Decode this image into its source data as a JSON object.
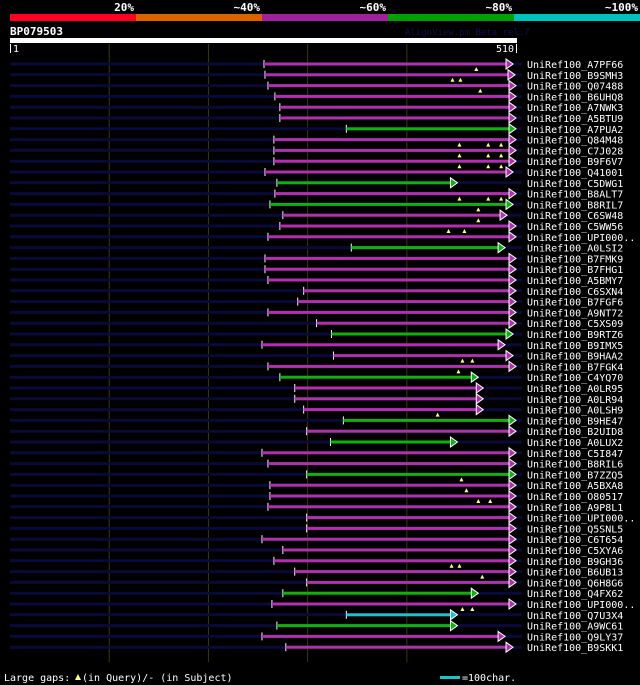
{
  "color_scale": {
    "labels": [
      "20%",
      "~40%",
      "~60%",
      "~80%",
      "~100%"
    ],
    "colors": [
      "#ff0022",
      "#e06000",
      "#a020a0",
      "#00a000",
      "#00c0c0"
    ]
  },
  "query": {
    "name": "BP079503",
    "start_label": "1",
    "end_label": "510",
    "length": 510
  },
  "watermark": "AlignView.pm Beta rel.7",
  "colors": {
    "magenta": "#b030b0",
    "green": "#10b010",
    "cyan": "#20c0d0",
    "background_line": "#0a0a3a",
    "grid": "#3a3a10",
    "gap_marker": "#ffff80"
  },
  "hits": [
    {
      "label": "UniRef100_A7PF66",
      "start": 256,
      "end": 507,
      "color": "magenta",
      "gaps": [
        470
      ]
    },
    {
      "label": "UniRef100_B9SMH3",
      "start": 257,
      "end": 509,
      "color": "magenta",
      "gaps": [
        446,
        454
      ]
    },
    {
      "label": "UniRef100_Q07488",
      "start": 260,
      "end": 510,
      "color": "magenta",
      "gaps": [
        474
      ]
    },
    {
      "label": "UniRef100_B6UHQ8",
      "start": 267,
      "end": 510,
      "color": "magenta",
      "gaps": []
    },
    {
      "label": "UniRef100_A7NWK3",
      "start": 272,
      "end": 510,
      "color": "magenta",
      "gaps": []
    },
    {
      "label": "UniRef100_A5BTU9",
      "start": 272,
      "end": 510,
      "color": "magenta",
      "gaps": []
    },
    {
      "label": "UniRef100_A7PUA2",
      "start": 339,
      "end": 510,
      "color": "green",
      "gaps": []
    },
    {
      "label": "UniRef100_Q84M48",
      "start": 266,
      "end": 510,
      "color": "magenta",
      "gaps": [
        453,
        482,
        495
      ]
    },
    {
      "label": "UniRef100_C7J028",
      "start": 266,
      "end": 510,
      "color": "magenta",
      "gaps": [
        453,
        482,
        495
      ]
    },
    {
      "label": "UniRef100_B9F6V7",
      "start": 266,
      "end": 510,
      "color": "magenta",
      "gaps": [
        453,
        482,
        495
      ]
    },
    {
      "label": "UniRef100_Q41001",
      "start": 257,
      "end": 507,
      "color": "magenta",
      "gaps": []
    },
    {
      "label": "UniRef100_C5DWG1",
      "start": 269,
      "end": 451,
      "color": "green",
      "gaps": []
    },
    {
      "label": "UniRef100_B8ALT7",
      "start": 267,
      "end": 510,
      "color": "magenta",
      "gaps": [
        453,
        482,
        495
      ]
    },
    {
      "label": "UniRef100_B8RIL7",
      "start": 262,
      "end": 507,
      "color": "green",
      "gaps": [
        472
      ]
    },
    {
      "label": "UniRef100_C6SW48",
      "start": 275,
      "end": 501,
      "color": "magenta",
      "gaps": [
        472
      ]
    },
    {
      "label": "UniRef100_C5WW56",
      "start": 272,
      "end": 510,
      "color": "magenta",
      "gaps": [
        442,
        458
      ]
    },
    {
      "label": "UniRef100_UPI000..",
      "start": 260,
      "end": 510,
      "color": "magenta",
      "gaps": []
    },
    {
      "label": "UniRef100_A0LSI2",
      "start": 344,
      "end": 499,
      "color": "green",
      "gaps": []
    },
    {
      "label": "UniRef100_B7FMK9",
      "start": 257,
      "end": 510,
      "color": "magenta",
      "gaps": []
    },
    {
      "label": "UniRef100_B7FHG1",
      "start": 257,
      "end": 510,
      "color": "magenta",
      "gaps": []
    },
    {
      "label": "UniRef100_A5BMY7",
      "start": 260,
      "end": 510,
      "color": "magenta",
      "gaps": []
    },
    {
      "label": "UniRef100_C6SXN4",
      "start": 296,
      "end": 510,
      "color": "magenta",
      "gaps": []
    },
    {
      "label": "UniRef100_B7FGF6",
      "start": 290,
      "end": 510,
      "color": "magenta",
      "gaps": []
    },
    {
      "label": "UniRef100_A9NT72",
      "start": 260,
      "end": 510,
      "color": "magenta",
      "gaps": []
    },
    {
      "label": "UniRef100_C5XS09",
      "start": 309,
      "end": 510,
      "color": "magenta",
      "gaps": []
    },
    {
      "label": "UniRef100_B9RTZ6",
      "start": 324,
      "end": 507,
      "color": "green",
      "gaps": []
    },
    {
      "label": "UniRef100_B9IMX5",
      "start": 254,
      "end": 499,
      "color": "magenta",
      "gaps": []
    },
    {
      "label": "UniRef100_B9HAA2",
      "start": 326,
      "end": 507,
      "color": "magenta",
      "gaps": [
        456,
        466
      ]
    },
    {
      "label": "UniRef100_B7FGK4",
      "start": 260,
      "end": 510,
      "color": "magenta",
      "gaps": [
        452
      ]
    },
    {
      "label": "UniRef100_C4YQ70",
      "start": 272,
      "end": 472,
      "color": "green",
      "gaps": []
    },
    {
      "label": "UniRef100_A0LR95",
      "start": 287,
      "end": 477,
      "color": "magenta",
      "gaps": []
    },
    {
      "label": "UniRef100_A0LR94",
      "start": 287,
      "end": 477,
      "color": "magenta",
      "gaps": []
    },
    {
      "label": "UniRef100_A0LSH9",
      "start": 296,
      "end": 477,
      "color": "magenta",
      "gaps": [
        431
      ]
    },
    {
      "label": "UniRef100_B9HE47",
      "start": 336,
      "end": 510,
      "color": "green",
      "gaps": []
    },
    {
      "label": "UniRef100_B2UID8",
      "start": 299,
      "end": 510,
      "color": "magenta",
      "gaps": []
    },
    {
      "label": "UniRef100_A0LUX2",
      "start": 323,
      "end": 451,
      "color": "green",
      "gaps": []
    },
    {
      "label": "UniRef100_C5I847",
      "start": 254,
      "end": 510,
      "color": "magenta",
      "gaps": []
    },
    {
      "label": "UniRef100_B8RIL6",
      "start": 260,
      "end": 510,
      "color": "magenta",
      "gaps": []
    },
    {
      "label": "UniRef100_B7ZZQ5",
      "start": 299,
      "end": 510,
      "color": "green",
      "gaps": [
        455
      ]
    },
    {
      "label": "UniRef100_A5BXA8",
      "start": 262,
      "end": 510,
      "color": "magenta",
      "gaps": [
        460
      ]
    },
    {
      "label": "UniRef100_O80517",
      "start": 262,
      "end": 510,
      "color": "magenta",
      "gaps": [
        472,
        484
      ]
    },
    {
      "label": "UniRef100_A9P8L1",
      "start": 260,
      "end": 510,
      "color": "magenta",
      "gaps": []
    },
    {
      "label": "UniRef100_UPI000..",
      "start": 299,
      "end": 510,
      "color": "magenta",
      "gaps": []
    },
    {
      "label": "UniRef100_Q5SNL5",
      "start": 299,
      "end": 510,
      "color": "magenta",
      "gaps": []
    },
    {
      "label": "UniRef100_C6T654",
      "start": 254,
      "end": 510,
      "color": "magenta",
      "gaps": []
    },
    {
      "label": "UniRef100_C5XYA6",
      "start": 275,
      "end": 510,
      "color": "magenta",
      "gaps": []
    },
    {
      "label": "UniRef100_B9GH36",
      "start": 266,
      "end": 510,
      "color": "magenta",
      "gaps": [
        445,
        453
      ]
    },
    {
      "label": "UniRef100_B6UB13",
      "start": 287,
      "end": 510,
      "color": "magenta",
      "gaps": [
        476
      ]
    },
    {
      "label": "UniRef100_Q6H8G6",
      "start": 299,
      "end": 510,
      "color": "magenta",
      "gaps": []
    },
    {
      "label": "UniRef100_Q4FX62",
      "start": 275,
      "end": 472,
      "color": "green",
      "gaps": []
    },
    {
      "label": "UniRef100_UPI000..",
      "start": 264,
      "end": 510,
      "color": "magenta",
      "gaps": [
        456,
        466
      ]
    },
    {
      "label": "UniRef100_Q7U3X4",
      "start": 339,
      "end": 451,
      "color": "cyan",
      "gaps": []
    },
    {
      "label": "UniRef100_A9WC61",
      "start": 269,
      "end": 451,
      "color": "green",
      "gaps": []
    },
    {
      "label": "UniRef100_Q9LY37",
      "start": 254,
      "end": 499,
      "color": "magenta",
      "gaps": []
    },
    {
      "label": "UniRef100_B9SKK1",
      "start": 278,
      "end": 507,
      "color": "magenta",
      "gaps": []
    }
  ],
  "legend": {
    "large_gaps_prefix": "Large gaps:",
    "large_gaps_query": "(in Query)/- (in Subject)",
    "scale_label": "=100char."
  }
}
